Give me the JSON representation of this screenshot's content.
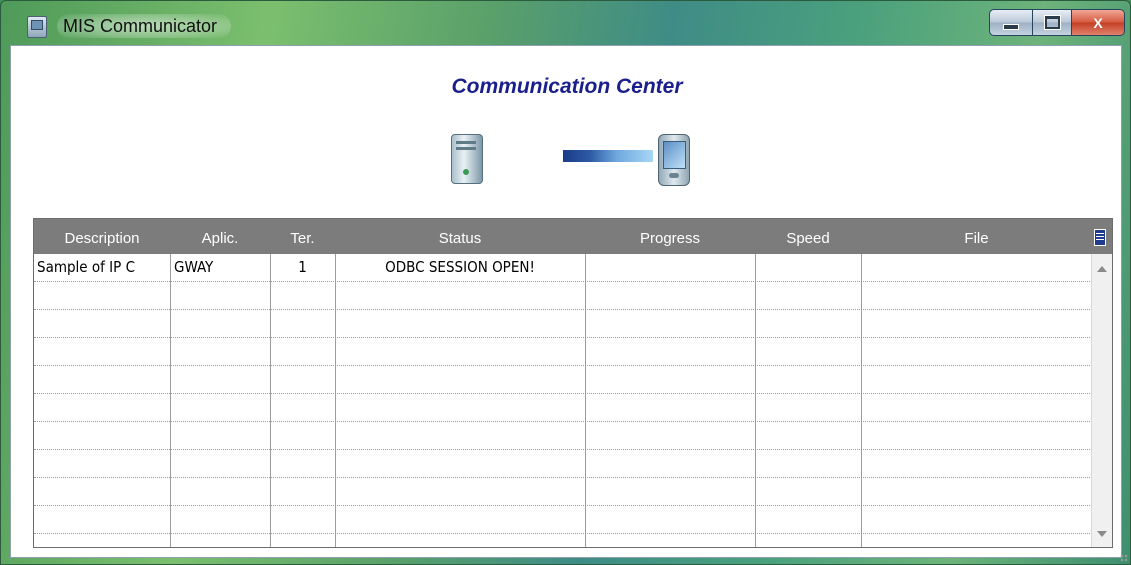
{
  "window": {
    "title": "MIS Communicator",
    "controls": {
      "minimize": "minimize",
      "maximize": "maximize",
      "close": "X"
    }
  },
  "header": {
    "title": "Communication Center",
    "icons": [
      "server-icon",
      "connection-bar",
      "pda-icon"
    ]
  },
  "grid": {
    "columns": [
      "Description",
      "Aplic.",
      "Ter.",
      "Status",
      "Progress",
      "Speed",
      "File"
    ],
    "rows": [
      {
        "description": "Sample of IP C",
        "aplic": "GWAY",
        "ter": "1",
        "status": "ODBC SESSION OPEN!",
        "progress": "",
        "speed": "",
        "file": ""
      },
      {
        "description": "",
        "aplic": "",
        "ter": "",
        "status": "",
        "progress": "",
        "speed": "",
        "file": ""
      },
      {
        "description": "",
        "aplic": "",
        "ter": "",
        "status": "",
        "progress": "",
        "speed": "",
        "file": ""
      },
      {
        "description": "",
        "aplic": "",
        "ter": "",
        "status": "",
        "progress": "",
        "speed": "",
        "file": ""
      },
      {
        "description": "",
        "aplic": "",
        "ter": "",
        "status": "",
        "progress": "",
        "speed": "",
        "file": ""
      },
      {
        "description": "",
        "aplic": "",
        "ter": "",
        "status": "",
        "progress": "",
        "speed": "",
        "file": ""
      },
      {
        "description": "",
        "aplic": "",
        "ter": "",
        "status": "",
        "progress": "",
        "speed": "",
        "file": ""
      },
      {
        "description": "",
        "aplic": "",
        "ter": "",
        "status": "",
        "progress": "",
        "speed": "",
        "file": ""
      },
      {
        "description": "",
        "aplic": "",
        "ter": "",
        "status": "",
        "progress": "",
        "speed": "",
        "file": ""
      },
      {
        "description": "",
        "aplic": "",
        "ter": "",
        "status": "",
        "progress": "",
        "speed": "",
        "file": ""
      }
    ]
  },
  "colors": {
    "title_blue": "#1a1f8c",
    "header_gray": "#7c7c7c",
    "close_red": "#c23f25"
  }
}
